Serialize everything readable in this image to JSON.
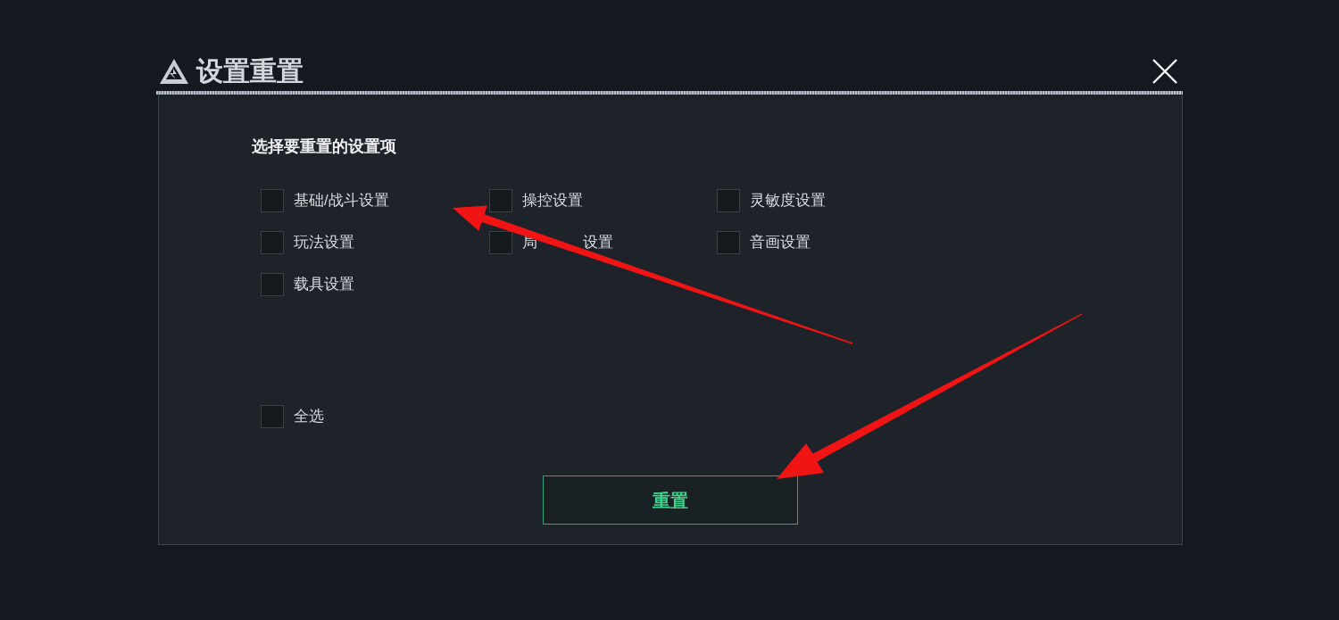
{
  "dialog": {
    "title": "设置重置"
  },
  "section": {
    "heading": "选择要重置的设置项"
  },
  "options": [
    {
      "label": "基础/战斗设置",
      "checked": false
    },
    {
      "label": "操控设置",
      "checked": false
    },
    {
      "label": "灵敏度设置",
      "checked": false
    },
    {
      "label": "玩法设置",
      "checked": false
    },
    {
      "label_parts": [
        "局",
        "设置"
      ],
      "checked": false
    },
    {
      "label": "音画设置",
      "checked": false
    },
    {
      "label": "载具设置",
      "checked": false
    }
  ],
  "select_all": {
    "label": "全选",
    "checked": false
  },
  "buttons": [
    {
      "label": "重置"
    }
  ]
}
